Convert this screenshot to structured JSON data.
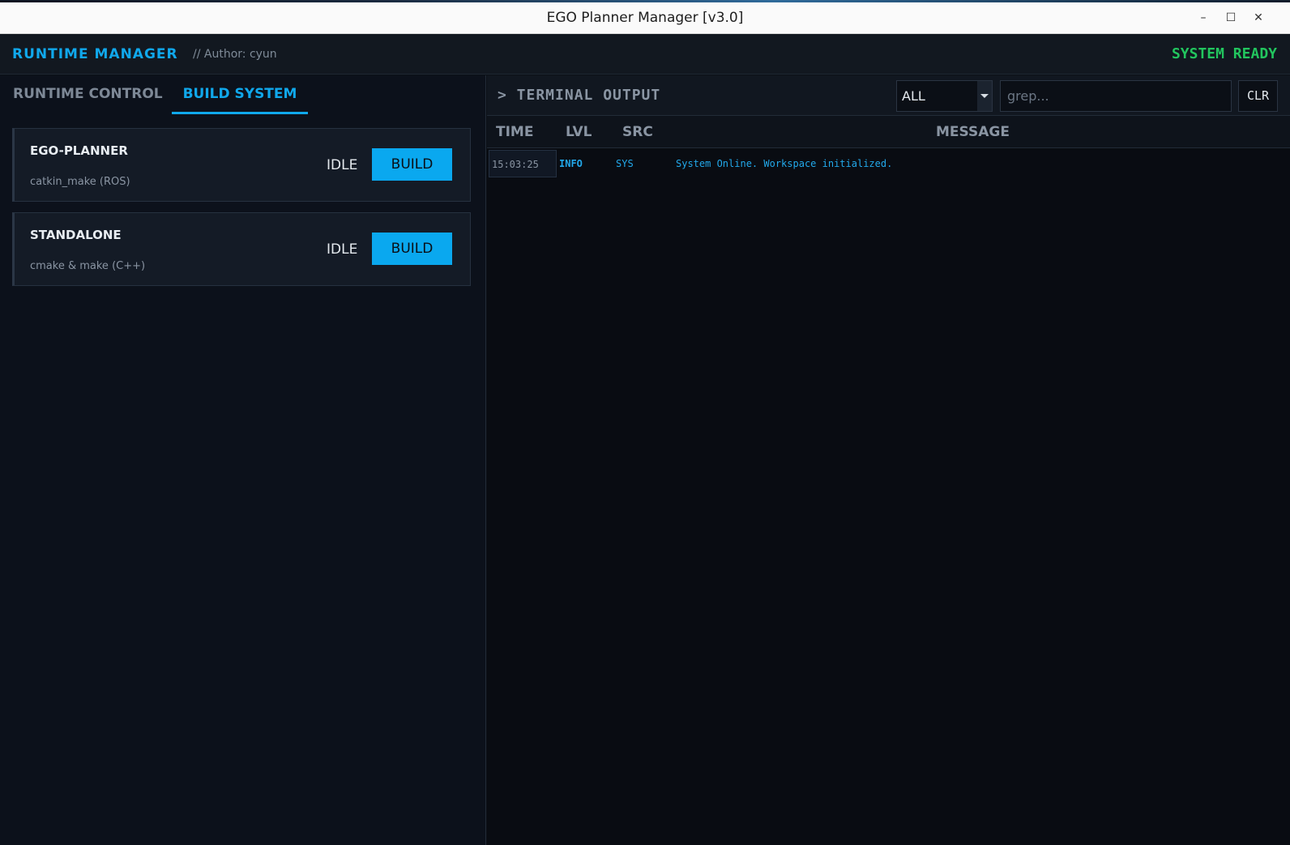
{
  "window": {
    "title": "EGO Planner Manager [v3.0]",
    "minimize": "–",
    "maximize": "☐",
    "close": "✕"
  },
  "header": {
    "brand": "RUNTIME MANAGER",
    "author": "// Author: cyun",
    "status": "SYSTEM READY"
  },
  "tabs": [
    {
      "label": "RUNTIME CONTROL",
      "active": false
    },
    {
      "label": "BUILD SYSTEM",
      "active": true
    }
  ],
  "build_targets": [
    {
      "name": "EGO-PLANNER",
      "command": "catkin_make (ROS)",
      "state": "IDLE",
      "button": "BUILD"
    },
    {
      "name": "STANDALONE",
      "command": "cmake & make (C++)",
      "state": "IDLE",
      "button": "BUILD"
    }
  ],
  "terminal": {
    "title": "> TERMINAL OUTPUT",
    "filter_value": "ALL",
    "grep_placeholder": "grep...",
    "clear_label": "CLR",
    "columns": [
      "TIME",
      "LVL",
      "SRC",
      "MESSAGE"
    ],
    "rows": [
      {
        "time": "15:03:25",
        "level": "INFO",
        "src": "SYS",
        "message": "System Online. Workspace initialized."
      }
    ]
  },
  "colors": {
    "accent": "#10a8ec",
    "ready": "#22c55e",
    "panel_bg": "#0c111b",
    "terminal_bg": "#090c12"
  }
}
